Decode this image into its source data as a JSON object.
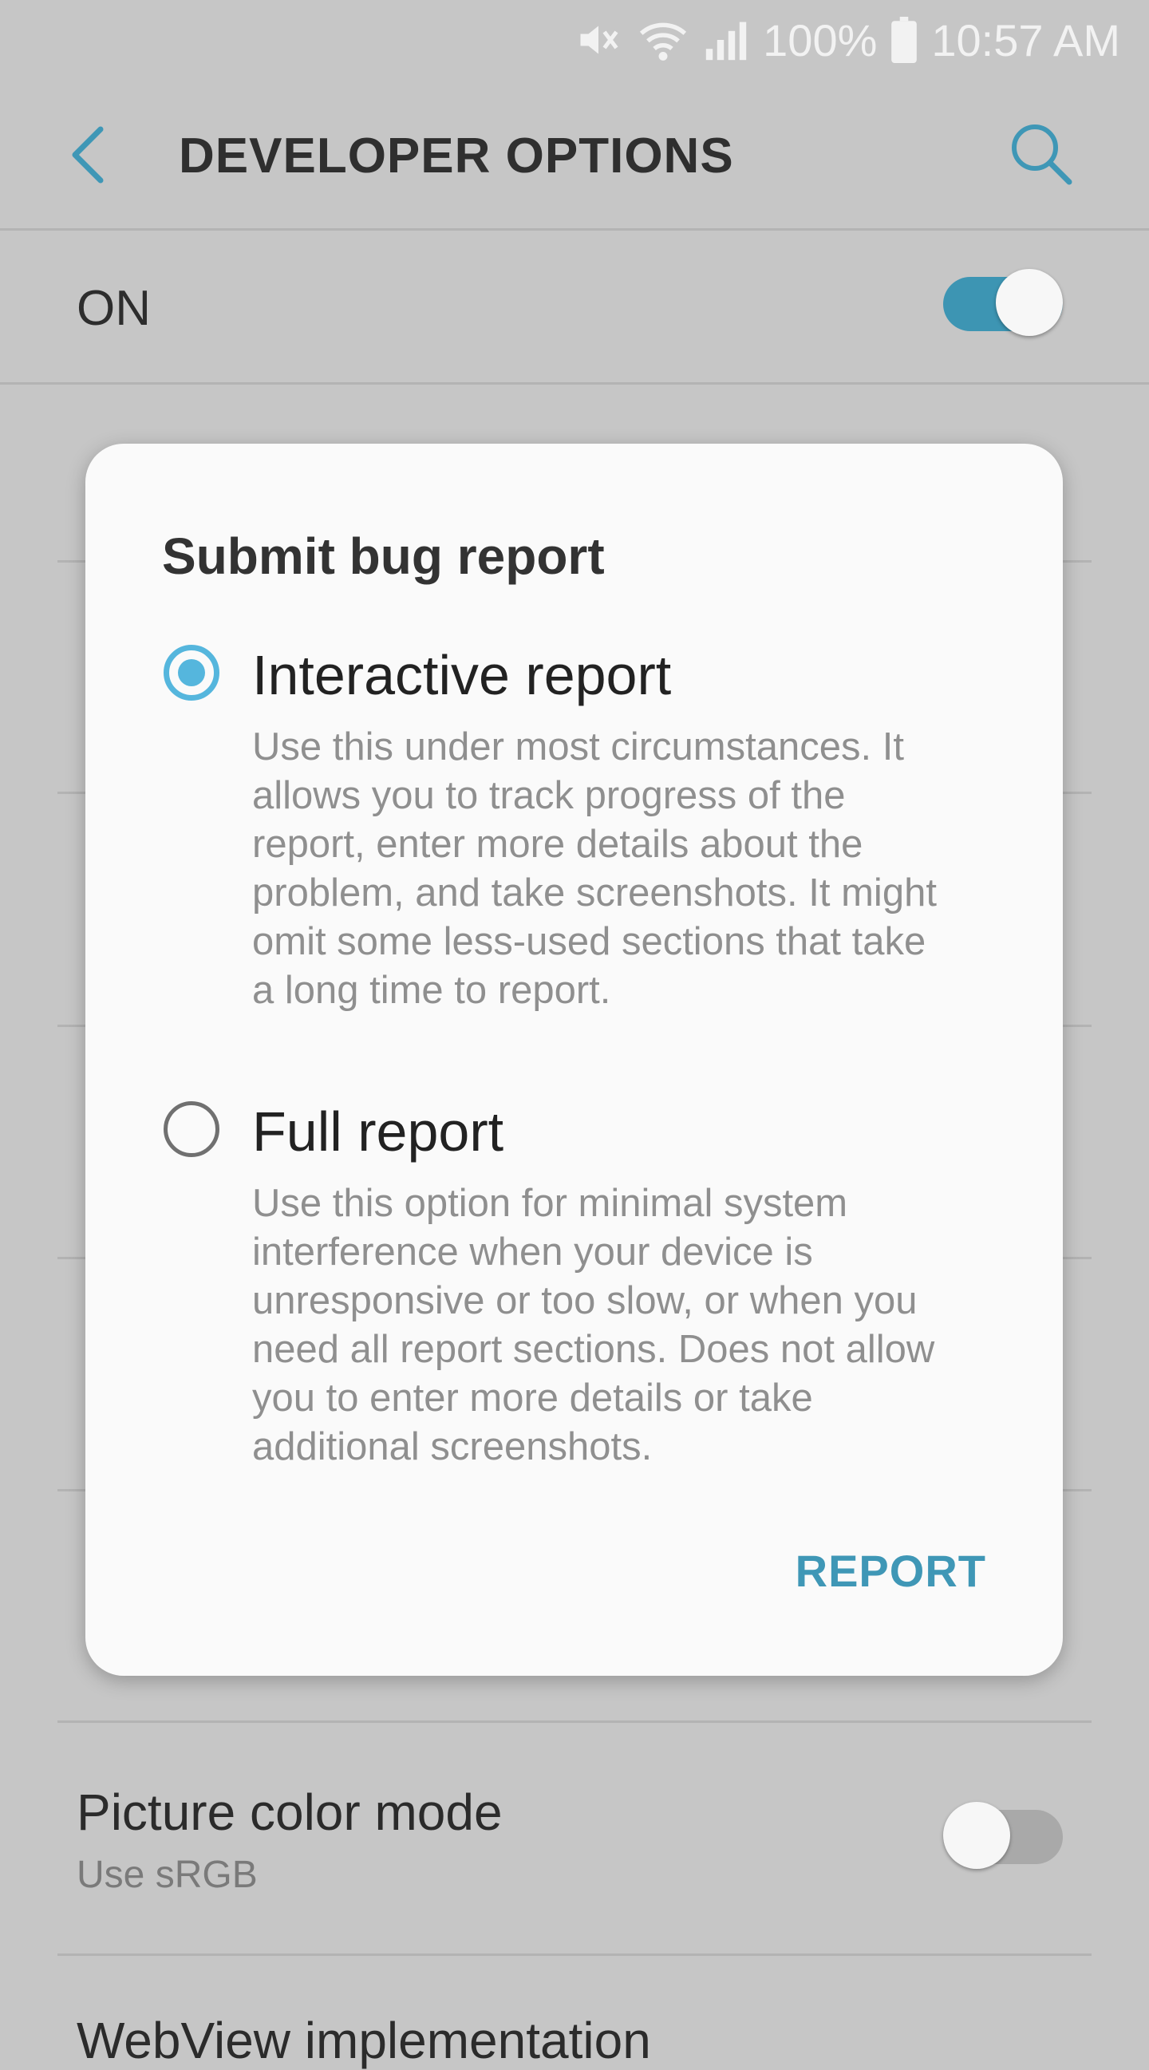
{
  "status_bar": {
    "battery_text": "100%",
    "time": "10:57 AM"
  },
  "app_bar": {
    "title": "DEVELOPER OPTIONS"
  },
  "master_switch": {
    "label": "ON",
    "state": true
  },
  "background_list": {
    "picture_color_mode": {
      "title": "Picture color mode",
      "subtitle": "Use sRGB",
      "state": false
    },
    "webview_implementation": {
      "title": "WebView implementation"
    }
  },
  "dialog": {
    "title": "Submit bug report",
    "options": [
      {
        "label": "Interactive report",
        "description": "Use this under most circumstances. It allows you to track progress of the report, enter more details about the problem, and take screenshots. It might omit some less-used sections that take a long time to report.",
        "selected": true
      },
      {
        "label": "Full report",
        "description": "Use this option for minimal system interference when your device is unresponsive or too slow, or when you need all report sections. Does not allow you to enter more details or take additional screenshots.",
        "selected": false
      }
    ],
    "action_label": "REPORT"
  },
  "colors": {
    "accent": "#3f97b6",
    "radio_selected": "#55b6dd",
    "scrim": "#c6c6c6"
  }
}
